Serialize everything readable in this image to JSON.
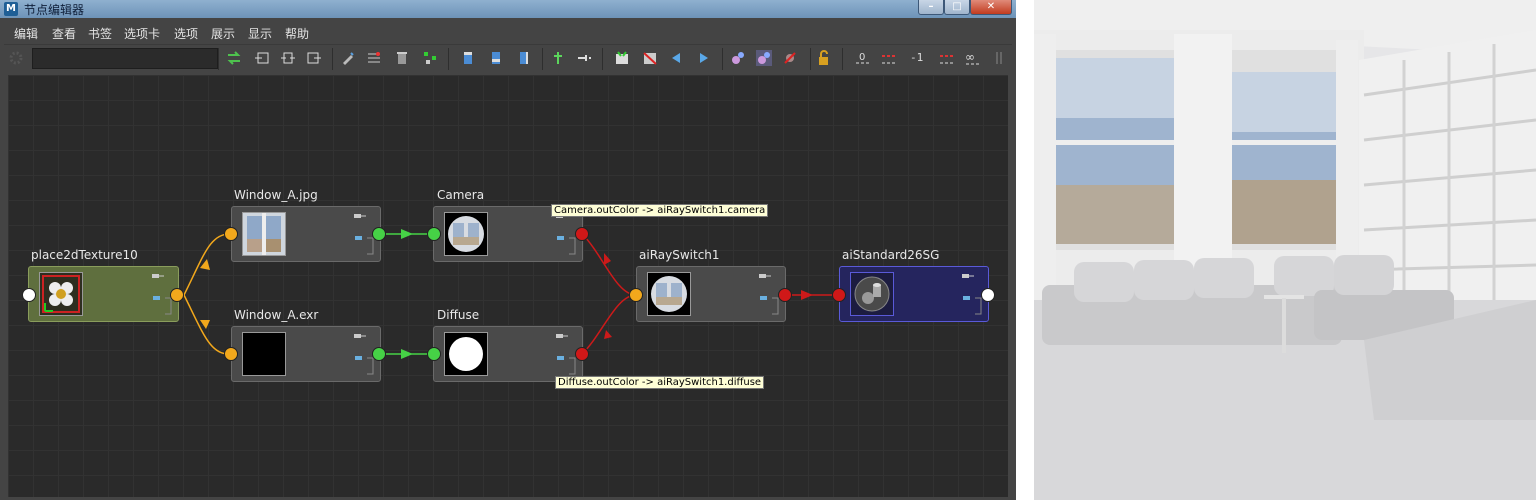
{
  "window": {
    "title": "节点编辑器",
    "app_icon_letter": "M"
  },
  "menubar": {
    "items": [
      "编辑",
      "查看",
      "书签",
      "选项卡",
      "选项",
      "展示",
      "显示",
      "帮助"
    ]
  },
  "toolbar": {
    "number_value": "-1",
    "filter_placeholder": ""
  },
  "graph": {
    "nodes": {
      "place2d": {
        "name": "place2dTexture10"
      },
      "window_jpg": {
        "name": "Window_A.jpg"
      },
      "window_exr": {
        "name": "Window_A.exr"
      },
      "camera": {
        "name": "Camera"
      },
      "diffuse": {
        "name": "Diffuse"
      },
      "rayswitch": {
        "name": "aiRaySwitch1"
      },
      "sg": {
        "name": "aiStandard26SG"
      }
    },
    "tooltips": {
      "camera": "Camera.outColor -> aiRaySwitch1.camera",
      "diffuse": "Diffuse.outColor -> aiRaySwitch1.diffuse"
    }
  },
  "colors": {
    "port_input_orange": "#f2a81c",
    "port_color_green": "#46d246",
    "port_out_red": "#d01818",
    "connection_red": "#cc1a1a",
    "node_green": "#5f6f3e",
    "node_blue": "#25255e"
  },
  "render_preview": {
    "description_icon": "rendered-room-image"
  }
}
